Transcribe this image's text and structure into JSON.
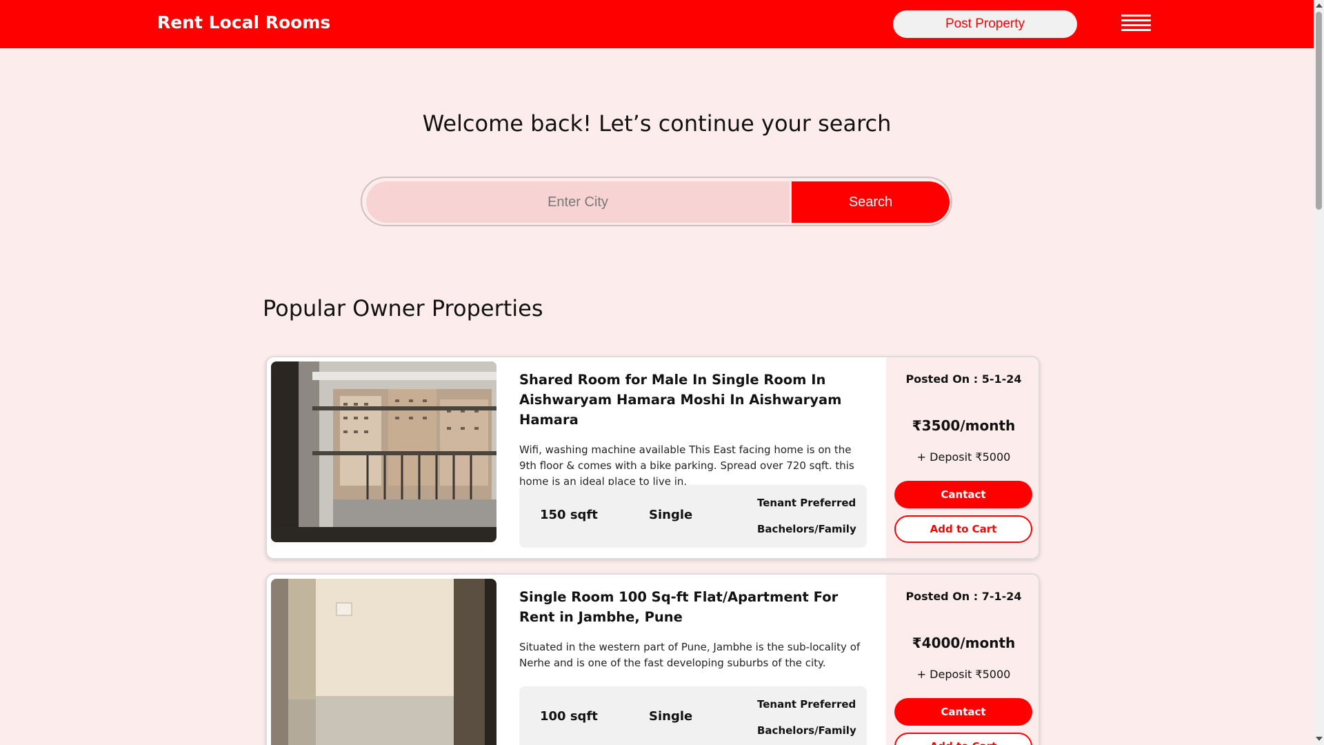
{
  "header": {
    "brand": "Rent Local Rooms",
    "post_property_label": "Post Property",
    "menu_icon": "hamburger-menu-icon"
  },
  "hero": {
    "welcome_text": "Welcome back! Let’s continue your search",
    "search_placeholder": "Enter City",
    "search_value": "",
    "search_button_label": "Search"
  },
  "properties": {
    "section_title": "Popular Owner Properties",
    "items": [
      {
        "title": "Shared Room for Male In Single Room In Aishwaryam Hamara Moshi In Aishwaryam Hamara",
        "description": "Wifi, washing machine available This East facing home is on the 9th floor & comes with a bike parking. Spread over 720 sqft. this home is an ideal place to live in.",
        "size": "150 sqft",
        "room_type": "Single",
        "tenant_label": "Tenant Preferred",
        "tenant_value": "Bachelors/Family",
        "posted_on": "Posted On : 5-1-24",
        "price": "₹3500/month",
        "deposit": "+ Deposit ₹5000",
        "contact_label": "Cantact",
        "cart_label": "Add to Cart"
      },
      {
        "title": "Single Room 100 Sq-ft Flat/Apartment For Rent in Jambhe, Pune",
        "description": "Situated in the western part of Pune, Jambhe is the sub-locality of Nerhe and is one of the fast developing suburbs of the city.",
        "size": "100 sqft",
        "room_type": "Single",
        "tenant_label": "Tenant Preferred",
        "tenant_value": "Bachelors/Family",
        "posted_on": "Posted On : 7-1-24",
        "price": "₹4000/month",
        "deposit": "+ Deposit ₹5000",
        "contact_label": "Cantact",
        "cart_label": "Add to Cart"
      }
    ]
  },
  "colors": {
    "brand_red": "#ff0000",
    "page_bg": "#fdecec",
    "input_bg": "#f8d3d3"
  }
}
